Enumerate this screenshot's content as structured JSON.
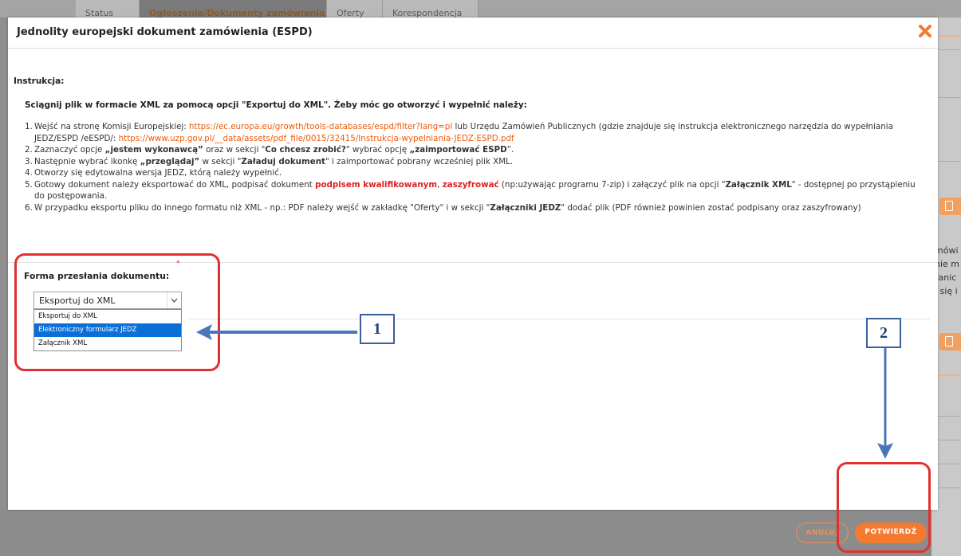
{
  "background": {
    "tabs": [
      {
        "label": "Status"
      },
      {
        "label": "Ogłoszenia/Dokumenty zamówienia"
      },
      {
        "label": "Oferty"
      },
      {
        "label": "Korespondencja"
      }
    ],
    "side_text": [
      "mówi",
      "nie m",
      "ranic",
      "j się i"
    ]
  },
  "modal": {
    "title": "Jednolity europejski dokument zamówienia (ESPD)",
    "instr_label": "Instrukcja:",
    "instr_head": "Sciągnij plik w formacie XML za pomocą opcji \"Exportuj do XML\". Żeby móc go otworzyć i wypełnić należy:",
    "steps": {
      "s1_num": "1.",
      "s1_a": "Wejść na stronę Komisji Europejskiej: ",
      "s1_link1": "https://ec.europa.eu/growth/tools-databases/espd/filter?lang=pl",
      "s1_b": " lub Urzędu Zamówień Publicznych (gdzie znajduje się instrukcja elektronicznego narzędzia do wypełniania JEDZ/ESPD /eESPD/: ",
      "s1_link2": "https://www.uzp.gov.pl/__data/assets/pdf_file/0015/32415/Instrukcja-wypelniania-JEDZ-ESPD.pdf",
      "s2_num": "2.",
      "s2_a": "Zaznaczyć opcje ",
      "s2_b": "„jestem wykonawcą”",
      "s2_c": " oraz w sekcji \"",
      "s2_d": "Co chcesz zrobić?",
      "s2_e": "\" wybrać opcję ",
      "s2_f": "„zaimportować ESPD",
      "s2_g": "”.",
      "s3_num": "3.",
      "s3_a": "Następnie wybrać ikonkę ",
      "s3_b": "„przeglądaj”",
      "s3_c": " w sekcji \"",
      "s3_d": "Załaduj dokument",
      "s3_e": "\" i zaimportować pobrany wcześniej plik XML.",
      "s4_num": "4.",
      "s4_a": "Otworzy się edytowalna wersja JEDZ, którą należy wypełnić.",
      "s5_num": "5.",
      "s5_a": "Gotowy dokument należy eksportować do XML, podpisać dokument ",
      "s5_b": "podpisem kwalifikowanym",
      "s5_c": ", ",
      "s5_d": "zaszyfrować",
      "s5_e": " (np:używając programu 7-zip) i załączyć plik na opcji \"",
      "s5_f": "Załącznik XML",
      "s5_g": "\" - dostępnej po przystąpieniu do postępowania.",
      "s6_num": "6.",
      "s6_a": "W przypadku eksportu pliku do innego formatu niż XML - np.: PDF należy wejść w zakładkę \"Oferty\" i w sekcji \"",
      "s6_b": "Załączniki JEDZ",
      "s6_c": "\" dodać plik (PDF również powinien zostać podpisany oraz zaszyfrowany)"
    },
    "form_label": "Forma przesłania dokumentu:",
    "required_mark": "*",
    "select_value": "Eksportuj do XML",
    "options": [
      "Eksportuj do XML",
      "Elektroniczny formularz JEDZ",
      "Załącznik XML"
    ],
    "cancel_label": "ANULUJ",
    "confirm_label": "POTWIERDŹ"
  },
  "annotations": {
    "label1": "1",
    "label2": "2"
  },
  "colors": {
    "accent": "#f47a30",
    "link": "#f05a0a",
    "annotation_red": "#e03030",
    "annotation_blue": "#3b6fb8"
  }
}
